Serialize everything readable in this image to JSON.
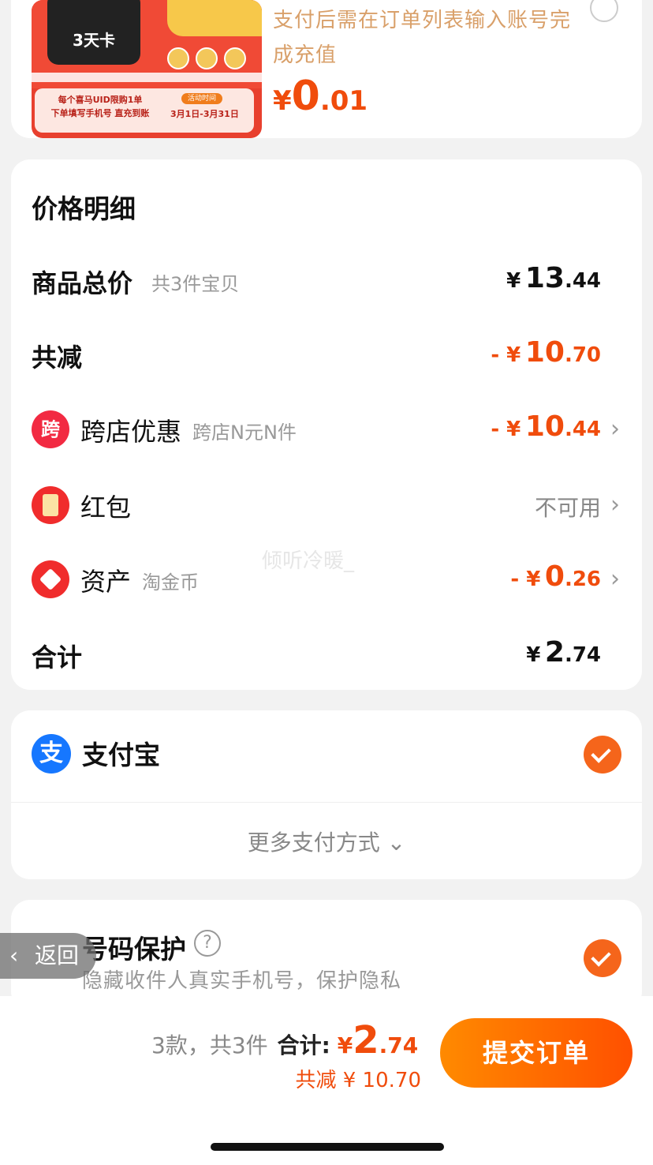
{
  "product": {
    "promo_card_text": "3天卡",
    "promo_banner_line1": "每个喜马UID限购1单",
    "promo_banner_line2": "下单填写手机号 直充到账",
    "promo_pill": "活动时间",
    "promo_date": "3月1日-3月31日",
    "recharge_note": "支付后需在订单列表输入账号完成充值",
    "price": {
      "symbol": "¥",
      "int": "0",
      "dec": ".01"
    }
  },
  "price_detail": {
    "title": "价格明细",
    "total": {
      "label": "商品总价",
      "sub": "共3件宝贝",
      "symbol": "¥",
      "int": "13",
      "dec": ".44"
    },
    "reduce": {
      "label": "共减",
      "symbol": "- ¥",
      "int": "10",
      "dec": ".70"
    },
    "cross_store": {
      "icon_text": "跨",
      "label": "跨店优惠",
      "sub": "跨店N元N件",
      "symbol": "- ¥",
      "int": "10",
      "dec": ".44"
    },
    "red_packet": {
      "label": "红包",
      "status": "不可用"
    },
    "assets": {
      "label": "资产",
      "sub": "淘金币",
      "symbol": "- ¥",
      "int": "0",
      "dec": ".26"
    },
    "sum": {
      "label": "合计",
      "symbol": "¥",
      "int": "2",
      "dec": ".74"
    }
  },
  "payment": {
    "icon_text": "支",
    "method": "支付宝",
    "more": "更多支付方式"
  },
  "protection": {
    "title": "号码保护",
    "help": "?",
    "desc": "隐藏收件人真实手机号，保护隐私"
  },
  "watermark": "倾听冷暖_",
  "back": {
    "label": "返回",
    "chevron": "‹"
  },
  "bottom": {
    "count": "3款，共3件",
    "total_label": "合计:",
    "symbol": "¥",
    "int": "2",
    "dec": ".74",
    "saved": "共减 ¥ 10.70",
    "submit": "提交订单"
  },
  "colors": {
    "accent": "#f04c0c",
    "button": "#ff6a00",
    "alipay": "#1677ff"
  }
}
